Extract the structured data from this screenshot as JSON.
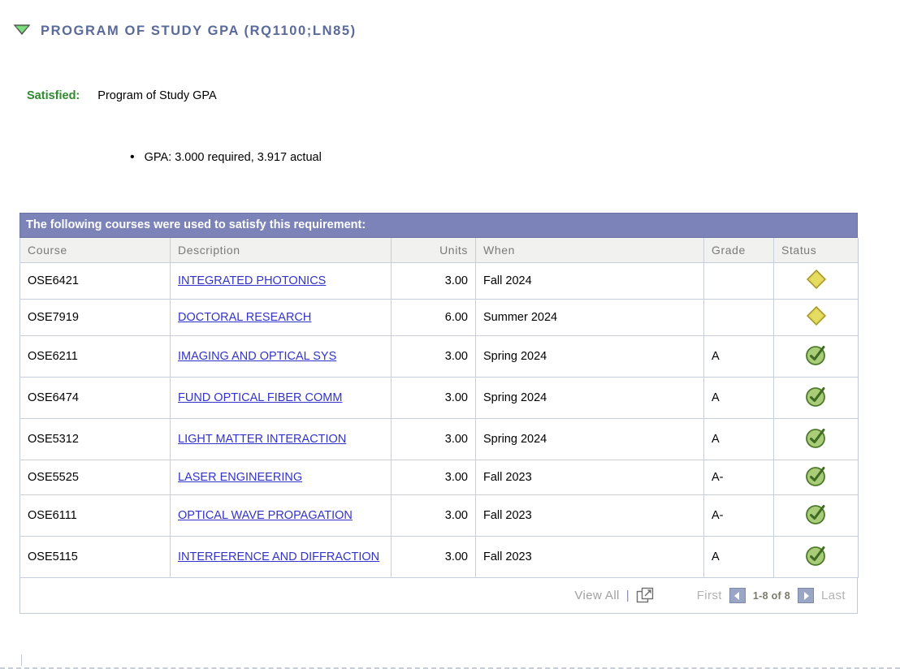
{
  "section": {
    "toggle_icon": "triangle-down-icon",
    "title": "PROGRAM OF STUDY GPA (RQ1100;LN85)"
  },
  "status": {
    "label": "Satisfied:",
    "value": "Program of Study GPA",
    "label_color": "#2e8b2e"
  },
  "details": {
    "bullet_char": "•",
    "text": "GPA: 3.000 required, 3.917 actual"
  },
  "table": {
    "caption": "The following courses were used to satisfy this requirement:",
    "caption_bg": "#7b83b8",
    "columns": [
      {
        "key": "course",
        "label": "Course"
      },
      {
        "key": "description",
        "label": "Description"
      },
      {
        "key": "units",
        "label": "Units"
      },
      {
        "key": "when",
        "label": "When"
      },
      {
        "key": "grade",
        "label": "Grade"
      },
      {
        "key": "status",
        "label": "Status"
      }
    ],
    "rows": [
      {
        "course": "OSE6421",
        "description": "INTEGRATED PHOTONICS",
        "units": "3.00",
        "when": "Fall 2024",
        "grade": "",
        "status_icon": "diamond-in-progress-icon",
        "two_line": false
      },
      {
        "course": "OSE7919",
        "description": "DOCTORAL RESEARCH",
        "units": "6.00",
        "when": "Summer 2024",
        "grade": "",
        "status_icon": "diamond-in-progress-icon",
        "two_line": false
      },
      {
        "course": "OSE6211",
        "description": "IMAGING AND OPTICAL SYS",
        "units": "3.00",
        "when": "Spring 2024",
        "grade": "A",
        "status_icon": "check-completed-icon",
        "two_line": true
      },
      {
        "course": "OSE6474",
        "description": "FUND OPTICAL FIBER COMM",
        "units": "3.00",
        "when": "Spring 2024",
        "grade": "A",
        "status_icon": "check-completed-icon",
        "two_line": true
      },
      {
        "course": "OSE5312",
        "description": "LIGHT MATTER INTERACTION",
        "units": "3.00",
        "when": "Spring 2024",
        "grade": "A",
        "status_icon": "check-completed-icon",
        "two_line": true
      },
      {
        "course": "OSE5525",
        "description": "LASER ENGINEERING",
        "units": "3.00",
        "when": "Fall 2023",
        "grade": "A-",
        "status_icon": "check-completed-icon",
        "two_line": false
      },
      {
        "course": "OSE6111",
        "description": "OPTICAL WAVE PROPAGATION",
        "units": "3.00",
        "when": "Fall 2023",
        "grade": "A-",
        "status_icon": "check-completed-icon",
        "two_line": true
      },
      {
        "course": "OSE5115",
        "description": "INTERFERENCE AND DIFFRACTION",
        "units": "3.00",
        "when": "Fall 2023",
        "grade": "A",
        "status_icon": "check-completed-icon",
        "two_line": true
      }
    ]
  },
  "pager": {
    "view_all": "View All",
    "separator": "|",
    "expand_icon": "open-in-new-window-icon",
    "first": "First",
    "prev_icon": "arrow-left-icon",
    "count": "1-8 of 8",
    "next_icon": "arrow-right-icon",
    "last": "Last"
  },
  "colors": {
    "link": "#3333cc",
    "header_bar": "#7b83b8",
    "satisfied_green": "#2e8b2e",
    "status_complete": "#8db85a",
    "status_inprogress": "#d9c547"
  }
}
